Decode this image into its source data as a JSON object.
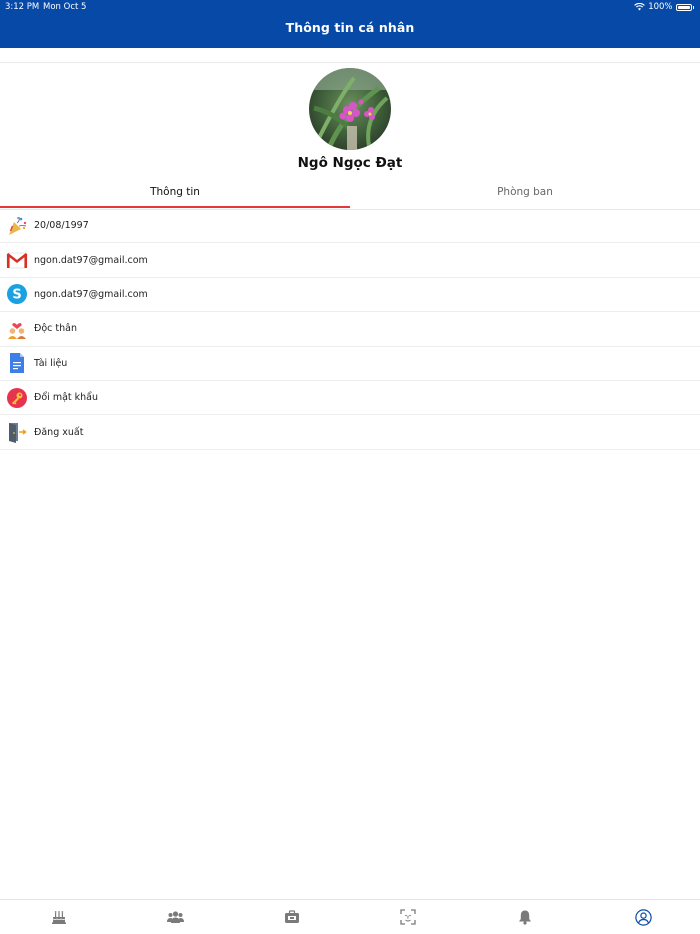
{
  "status_bar": {
    "time": "3:12 PM",
    "date": "Mon Oct 5",
    "battery": "100%"
  },
  "header": {
    "title": "Thông tin cá nhân"
  },
  "profile": {
    "name": "Ngô Ngọc Đạt"
  },
  "tabs": [
    {
      "label": "Thông tin",
      "active": true
    },
    {
      "label": "Phòng ban",
      "active": false
    }
  ],
  "info_rows": [
    {
      "icon": "party-popper-icon",
      "label": "20/08/1997"
    },
    {
      "icon": "gmail-icon",
      "label": "ngon.dat97@gmail.com"
    },
    {
      "icon": "skype-icon",
      "label": "ngon.dat97@gmail.com"
    },
    {
      "icon": "couple-icon",
      "label": "Độc thân"
    },
    {
      "icon": "document-icon",
      "label": "Tài liệu"
    },
    {
      "icon": "key-icon",
      "label": "Đổi mật khẩu"
    },
    {
      "icon": "logout-icon",
      "label": "Đăng xuất"
    }
  ],
  "bottom_nav": [
    {
      "icon": "birthday-cake-icon",
      "active": false
    },
    {
      "icon": "people-icon",
      "active": false
    },
    {
      "icon": "briefcase-icon",
      "active": false
    },
    {
      "icon": "face-scan-icon",
      "active": false
    },
    {
      "icon": "bell-icon",
      "active": false
    },
    {
      "icon": "profile-icon",
      "active": true
    }
  ],
  "colors": {
    "header": "#0749a6",
    "tab_indicator": "#e53935",
    "active_nav": "#0749a6",
    "inactive_nav": "#7a7a7a"
  }
}
